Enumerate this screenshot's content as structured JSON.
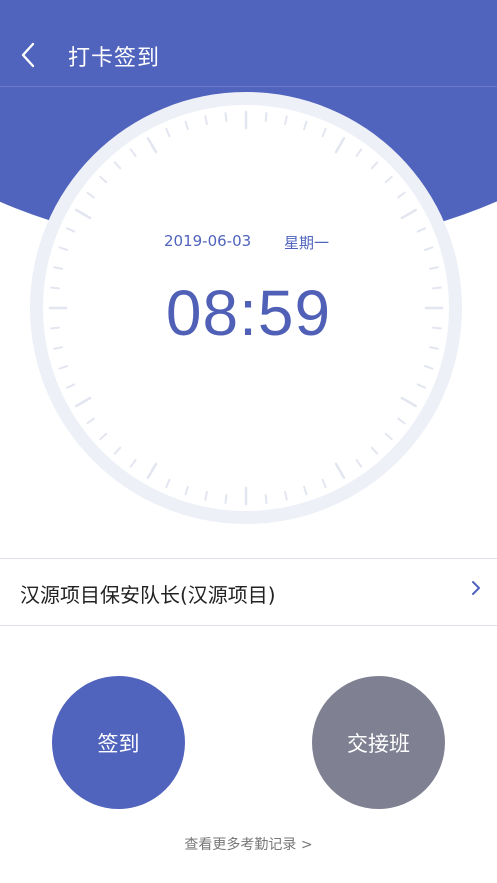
{
  "header": {
    "title": "打卡签到",
    "back_icon": "chevron-left-icon"
  },
  "clock": {
    "date": "2019-06-03",
    "weekday": "星期一",
    "time": "08:59"
  },
  "post": {
    "label": "汉源项目保安队长(汉源项目)",
    "chevron_icon": "chevron-right-icon"
  },
  "actions": {
    "sign_in_label": "签到",
    "handover_label": "交接班"
  },
  "footer": {
    "more_records_label": "查看更多考勤记录 >"
  },
  "colors": {
    "primary": "#5063bd",
    "secondary_button": "#7f8193",
    "ring": "#eef0f7"
  }
}
